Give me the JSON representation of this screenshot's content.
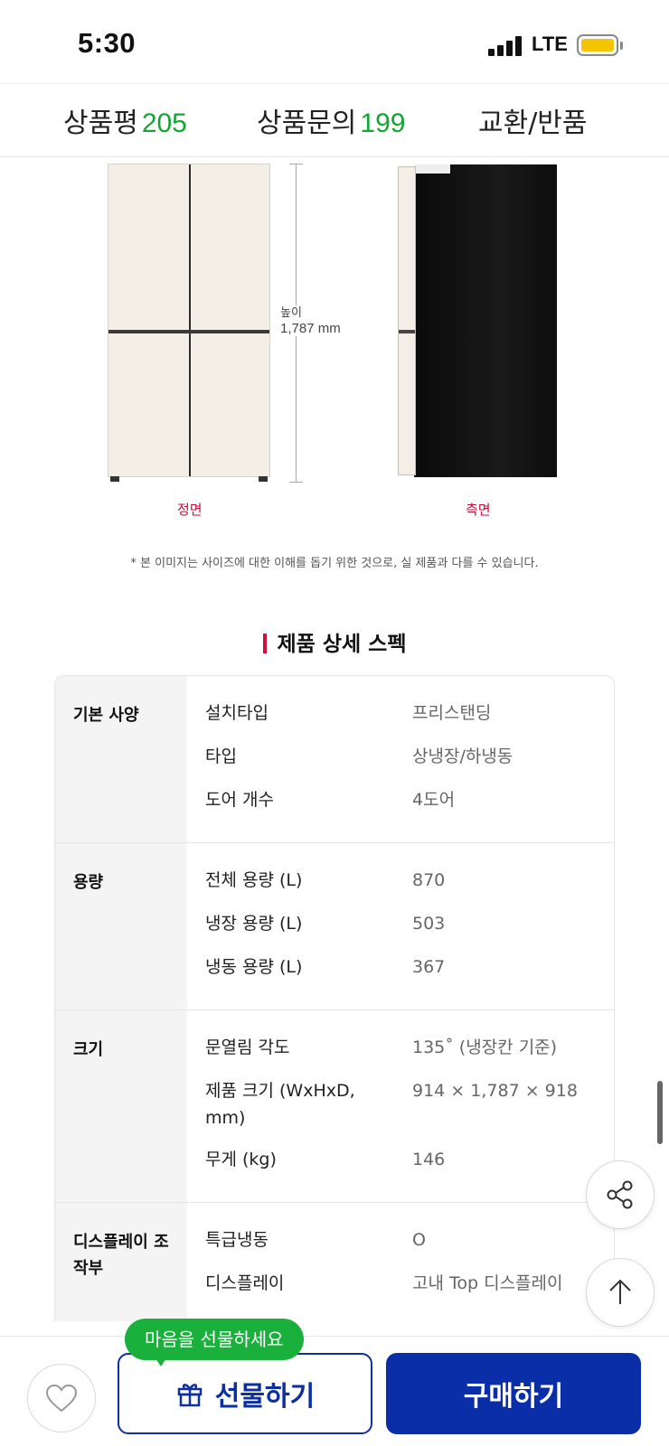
{
  "status_bar": {
    "time": "5:30",
    "network": "LTE"
  },
  "tabs": [
    {
      "label": "상품평",
      "count": "205"
    },
    {
      "label": "상품문의",
      "count": "199"
    },
    {
      "label": "교환/반품",
      "count": ""
    }
  ],
  "product_images": {
    "height_label": "높이",
    "height_value": "1,787 mm",
    "front_caption": "정면",
    "side_caption": "측면",
    "disclaimer": "* 본 이미지는 사이즈에 대한 이해를 돕기 위한 것으로, 실 제품과 다를 수 있습니다."
  },
  "spec": {
    "title": "제품 상세 스펙",
    "groups": [
      {
        "name": "기본 사양",
        "rows": [
          {
            "label": "설치타입",
            "value": "프리스탠딩"
          },
          {
            "label": "타입",
            "value": "상냉장/하냉동"
          },
          {
            "label": "도어 개수",
            "value": "4도어"
          }
        ]
      },
      {
        "name": "용량",
        "rows": [
          {
            "label": "전체 용량 (L)",
            "value": "870"
          },
          {
            "label": "냉장 용량 (L)",
            "value": "503"
          },
          {
            "label": "냉동 용량 (L)",
            "value": "367"
          }
        ]
      },
      {
        "name": "크기",
        "rows": [
          {
            "label": "문열림 각도",
            "value": "135˚ (냉장칸 기준)"
          },
          {
            "label": "제품 크기 (WxHxD, mm)",
            "value": "914 × 1,787 × 918"
          },
          {
            "label": "무게 (kg)",
            "value": "146"
          }
        ]
      },
      {
        "name": "디스플레이 조작부",
        "rows": [
          {
            "label": "특급냉동",
            "value": "O"
          },
          {
            "label": "디스플레이",
            "value": "고내 Top 디스플레이"
          }
        ]
      }
    ]
  },
  "bottom_bar": {
    "gift_tooltip": "마음을 선물하세요",
    "gift_label": "선물하기",
    "buy_label": "구매하기"
  },
  "colors": {
    "accent_green": "#12a633",
    "brand_blue": "#0a2ea8",
    "caption_red": "#c0103c",
    "bubble_green": "#19b13b"
  },
  "icons": [
    "signal-icon",
    "battery-icon",
    "share-icon",
    "arrow-up-icon",
    "heart-icon",
    "gift-icon"
  ]
}
